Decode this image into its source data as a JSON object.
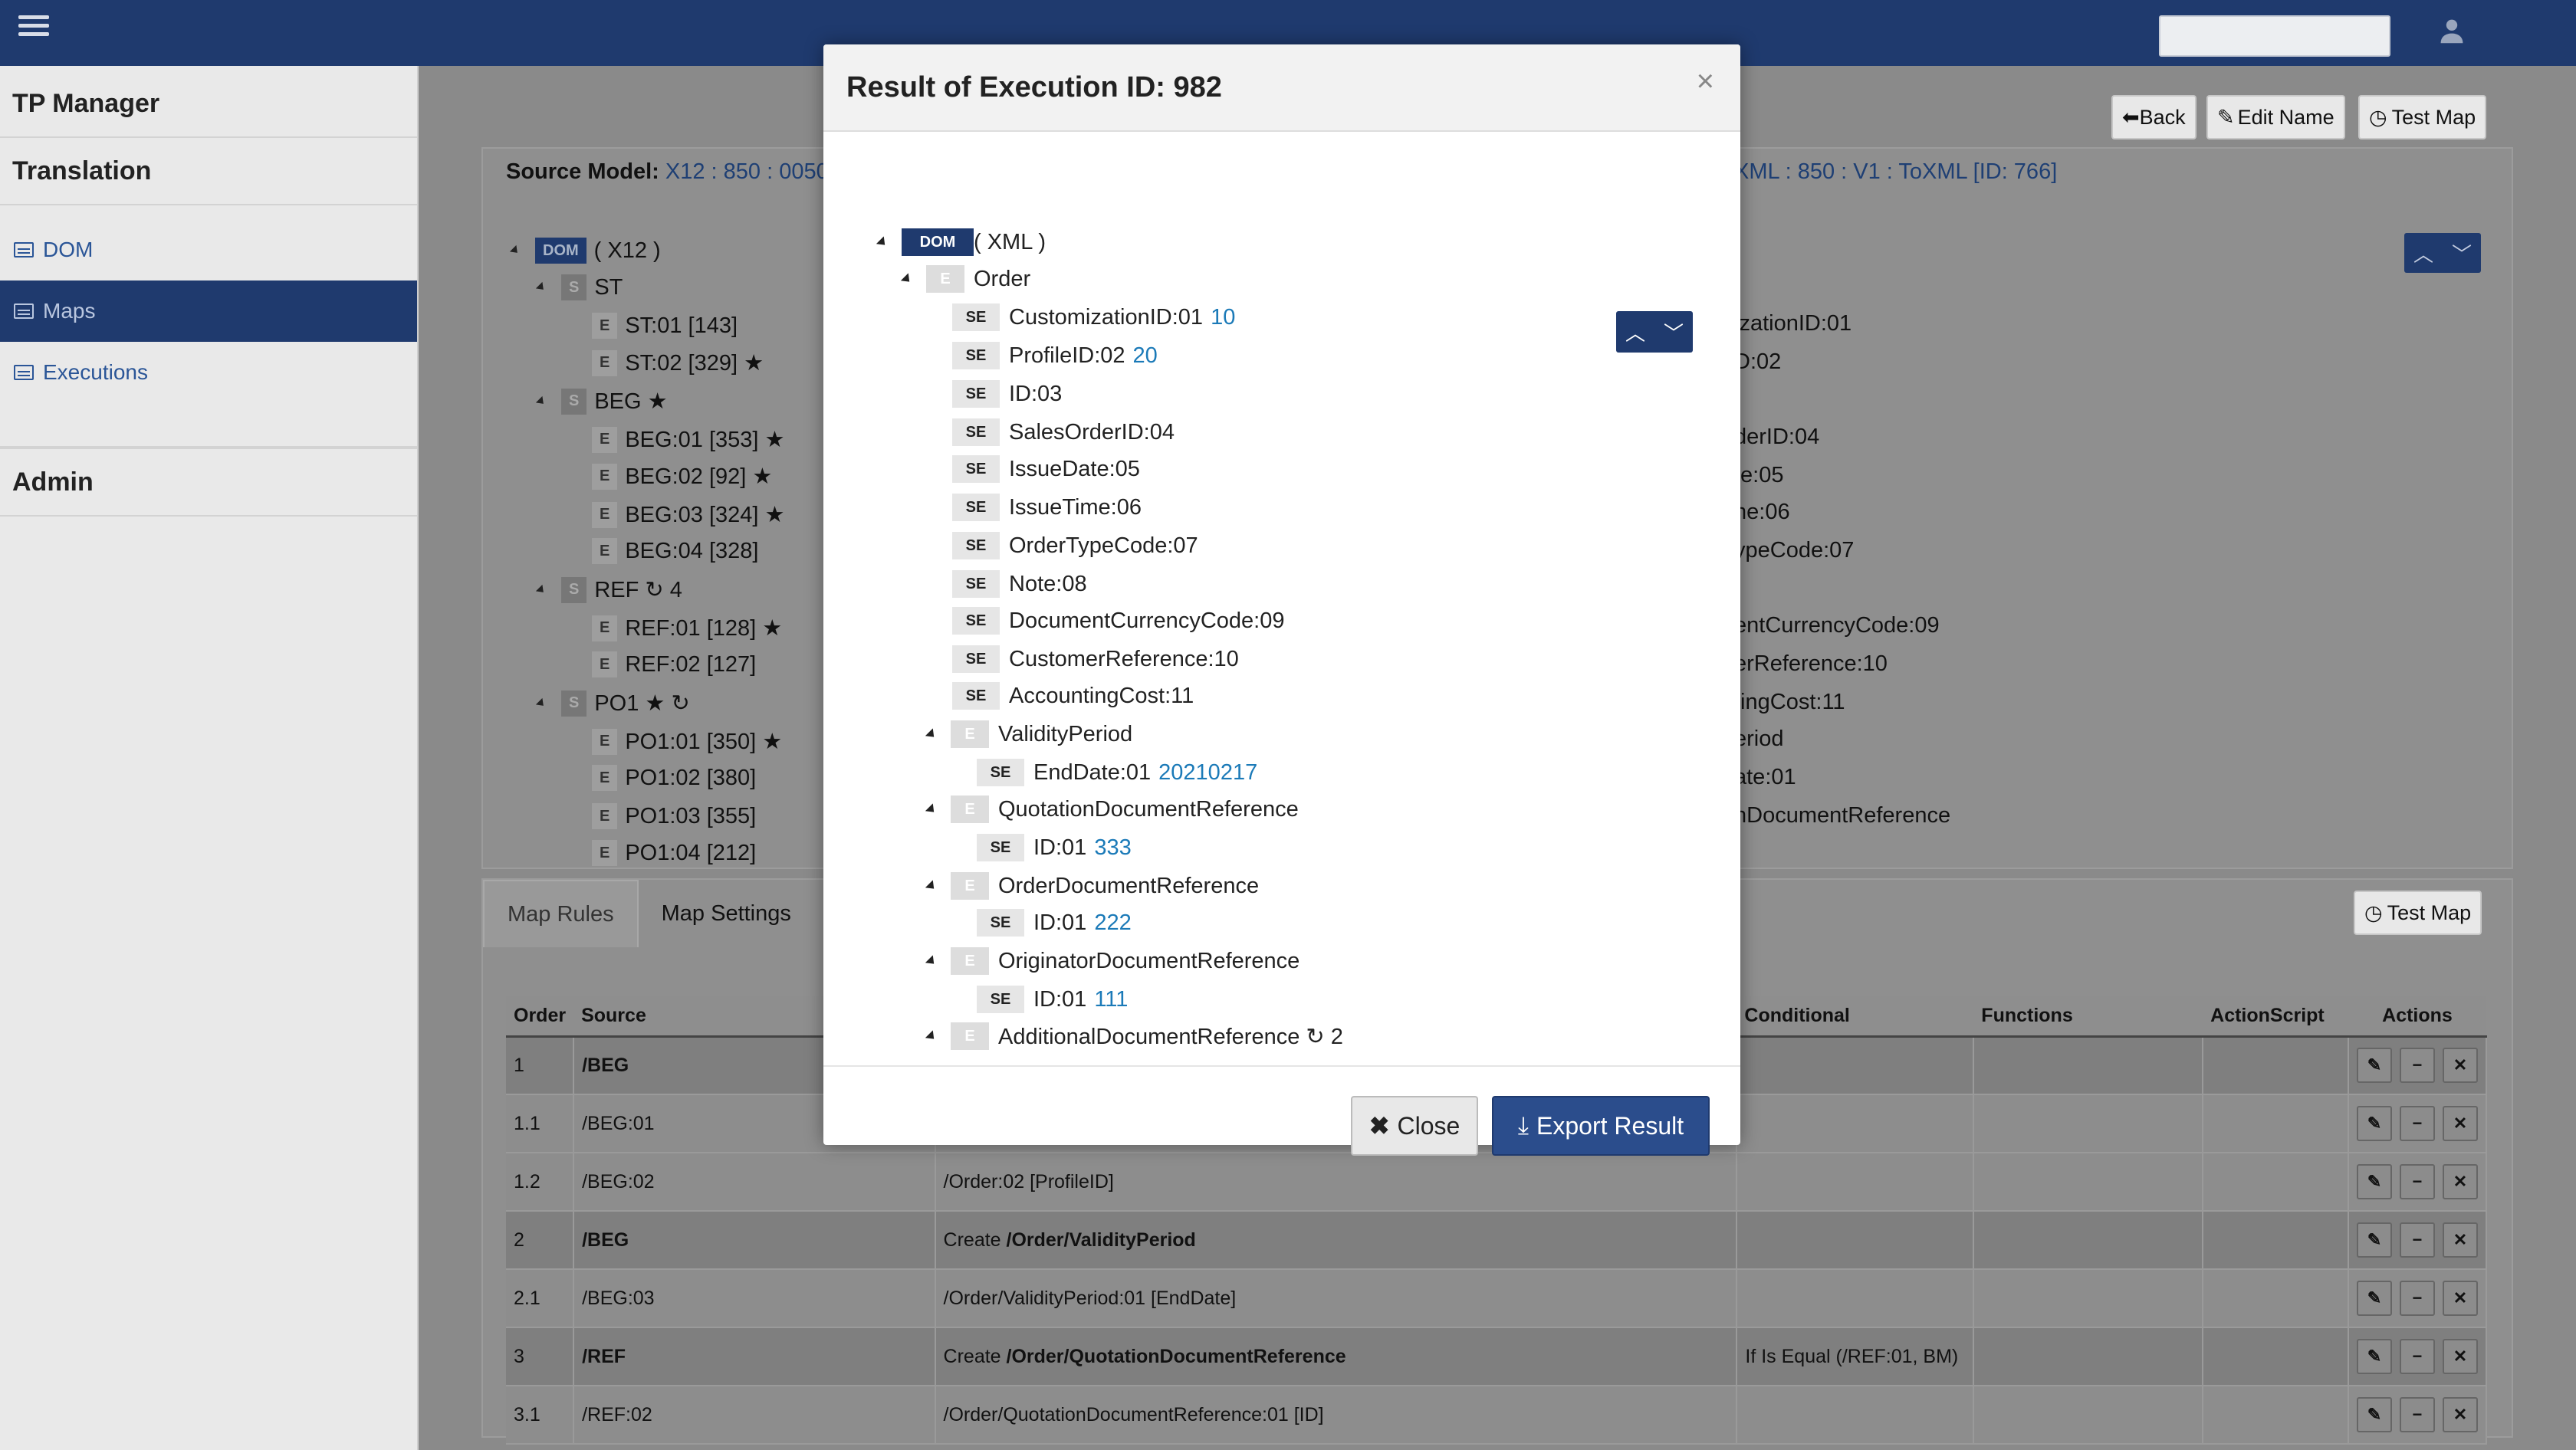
{
  "topbar": {
    "menu_icon": "hamburger-icon",
    "user_icon": "user-icon"
  },
  "sidebar": {
    "sections": [
      {
        "title": "TP Manager"
      },
      {
        "title": "Translation"
      }
    ],
    "items": [
      {
        "label": "DOM",
        "icon": "list-icon",
        "active": false
      },
      {
        "label": "Maps",
        "icon": "table-icon",
        "active": true
      },
      {
        "label": "Executions",
        "icon": "table-icon",
        "active": false
      }
    ],
    "admin": "Admin"
  },
  "toolbar": {
    "back": "Back",
    "edit_name": "Edit Name",
    "test_map": "Test Map"
  },
  "source": {
    "label": "Source Model:",
    "value": "X12 : 850 : 0050"
  },
  "target": {
    "value": "XML : 850 : V1 : ToXML [ID: 766]"
  },
  "source_tree": {
    "root_tag": "DOM",
    "root_label": "( X12 )",
    "rows": [
      {
        "tag": "S",
        "text": "ST"
      },
      {
        "tag": "E",
        "text": "ST:01 [143]"
      },
      {
        "tag": "E",
        "text": "ST:02 [329] ★"
      },
      {
        "tag": "S",
        "text": "BEG ★"
      },
      {
        "tag": "E",
        "text": "BEG:01 [353] ★"
      },
      {
        "tag": "E",
        "text": "BEG:02 [92] ★"
      },
      {
        "tag": "E",
        "text": "BEG:03 [324] ★"
      },
      {
        "tag": "E",
        "text": "BEG:04 [328]"
      },
      {
        "tag": "S",
        "text": "REF ↻ 4"
      },
      {
        "tag": "E",
        "text": "REF:01 [128] ★"
      },
      {
        "tag": "E",
        "text": "REF:02 [127]"
      },
      {
        "tag": "S",
        "text": "PO1 ★ ↻"
      },
      {
        "tag": "E",
        "text": "PO1:01 [350] ★"
      },
      {
        "tag": "E",
        "text": "PO1:02 [380]"
      },
      {
        "tag": "E",
        "text": "PO1:03 [355]"
      },
      {
        "tag": "E",
        "text": "PO1:04 [212]"
      }
    ]
  },
  "target_list": [
    "izationID:01",
    "D:02",
    "derID:04",
    "te:05",
    "ne:06",
    "ypeCode:07",
    "entCurrencyCode:09",
    "erReference:10",
    "tingCost:11",
    "eriod",
    "ate:01",
    "nDocumentReference"
  ],
  "tabs": {
    "map_rules": "Map Rules",
    "map_settings": "Map Settings",
    "test_map": "Test Map"
  },
  "rules": {
    "headers": {
      "order": "Order",
      "source": "Source",
      "conditional": "Conditional",
      "functions": "Functions",
      "actionscript": "ActionScript",
      "actions": "Actions"
    },
    "rows": [
      {
        "order": "1",
        "source": "/BEG",
        "target": "",
        "target_bold": "",
        "conditional": ""
      },
      {
        "order": "1.1",
        "source": "/BEG:01",
        "target": "",
        "target_bold": "",
        "conditional": ""
      },
      {
        "order": "1.2",
        "source": "/BEG:02",
        "target": "/Order:02 [ProfileID]",
        "target_bold": "",
        "conditional": ""
      },
      {
        "order": "2",
        "source": "/BEG",
        "target": "Create ",
        "target_bold": "/Order/ValidityPeriod",
        "conditional": ""
      },
      {
        "order": "2.1",
        "source": "/BEG:03",
        "target": "/Order/ValidityPeriod:01 [EndDate]",
        "target_bold": "",
        "conditional": ""
      },
      {
        "order": "3",
        "source": "/REF",
        "target": "Create ",
        "target_bold": "/Order/QuotationDocumentReference",
        "conditional": "If Is Equal (/REF:01, BM)"
      },
      {
        "order": "3.1",
        "source": "/REF:02",
        "target": "/Order/QuotationDocumentReference:01 [ID]",
        "target_bold": "",
        "conditional": ""
      }
    ]
  },
  "modal": {
    "title": "Result of Execution ID: 982",
    "close_x": "×",
    "root_tag": "DOM",
    "root_label": "( XML )",
    "tree": [
      {
        "tag": "E",
        "label": "Order",
        "value": ""
      },
      {
        "tag": "SE",
        "label": "CustomizationID:01",
        "value": "10"
      },
      {
        "tag": "SE",
        "label": "ProfileID:02",
        "value": "20"
      },
      {
        "tag": "SE",
        "label": "ID:03",
        "value": ""
      },
      {
        "tag": "SE",
        "label": "SalesOrderID:04",
        "value": ""
      },
      {
        "tag": "SE",
        "label": "IssueDate:05",
        "value": ""
      },
      {
        "tag": "SE",
        "label": "IssueTime:06",
        "value": ""
      },
      {
        "tag": "SE",
        "label": "OrderTypeCode:07",
        "value": ""
      },
      {
        "tag": "SE",
        "label": "Note:08",
        "value": ""
      },
      {
        "tag": "SE",
        "label": "DocumentCurrencyCode:09",
        "value": ""
      },
      {
        "tag": "SE",
        "label": "CustomerReference:10",
        "value": ""
      },
      {
        "tag": "SE",
        "label": "AccountingCost:11",
        "value": ""
      },
      {
        "tag": "E",
        "label": "ValidityPeriod",
        "value": ""
      },
      {
        "tag": "SE",
        "label": "EndDate:01",
        "value": "20210217"
      },
      {
        "tag": "E",
        "label": "QuotationDocumentReference",
        "value": ""
      },
      {
        "tag": "SE",
        "label": "ID:01",
        "value": "333"
      },
      {
        "tag": "E",
        "label": "OrderDocumentReference",
        "value": ""
      },
      {
        "tag": "SE",
        "label": "ID:01",
        "value": "222"
      },
      {
        "tag": "E",
        "label": "OriginatorDocumentReference",
        "value": ""
      },
      {
        "tag": "SE",
        "label": "ID:01",
        "value": "111"
      },
      {
        "tag": "E",
        "label": "AdditionalDocumentReference ↻ 2",
        "value": ""
      }
    ],
    "buttons": {
      "close": "Close",
      "export": "Export Result"
    }
  }
}
